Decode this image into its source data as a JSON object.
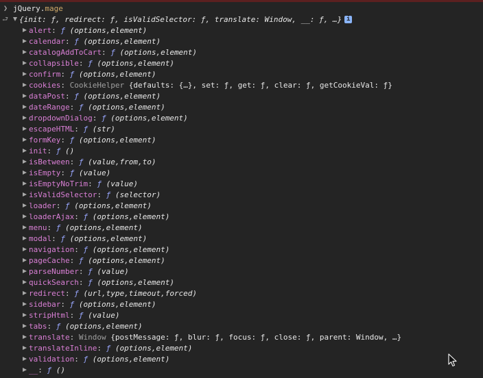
{
  "colors": {
    "background": "#242424",
    "key": "#d97fd5",
    "function_symbol": "#9aa8ff",
    "text": "#e8e8e8",
    "class_name": "#a0a0a0",
    "accent_top": "#5c2020"
  },
  "input": {
    "object": "jQuery.",
    "property": "mage"
  },
  "summary": {
    "text": "{init: ƒ, redirect: ƒ, isValidSelector: ƒ, translate: Window, __: ƒ, …}",
    "info_badge": "i"
  },
  "properties": [
    {
      "key": "alert",
      "sym": "ƒ",
      "sig": "(options,element)"
    },
    {
      "key": "calendar",
      "sym": "ƒ",
      "sig": "(options,element)"
    },
    {
      "key": "catalogAddToCart",
      "sym": "ƒ",
      "sig": "(options,element)"
    },
    {
      "key": "collapsible",
      "sym": "ƒ",
      "sig": "(options,element)"
    },
    {
      "key": "confirm",
      "sym": "ƒ",
      "sig": "(options,element)"
    },
    {
      "key": "cookies",
      "cls": "CookieHelper",
      "rest": "{defaults: {…}, set: ƒ, get: ƒ, clear: ƒ, getCookieVal: ƒ}"
    },
    {
      "key": "dataPost",
      "sym": "ƒ",
      "sig": "(options,element)"
    },
    {
      "key": "dateRange",
      "sym": "ƒ",
      "sig": "(options,element)"
    },
    {
      "key": "dropdownDialog",
      "sym": "ƒ",
      "sig": "(options,element)"
    },
    {
      "key": "escapeHTML",
      "sym": "ƒ",
      "sig": "(str)"
    },
    {
      "key": "formKey",
      "sym": "ƒ",
      "sig": "(options,element)"
    },
    {
      "key": "init",
      "sym": "ƒ",
      "sig": "()"
    },
    {
      "key": "isBetween",
      "sym": "ƒ",
      "sig": "(value,from,to)"
    },
    {
      "key": "isEmpty",
      "sym": "ƒ",
      "sig": "(value)"
    },
    {
      "key": "isEmptyNoTrim",
      "sym": "ƒ",
      "sig": "(value)"
    },
    {
      "key": "isValidSelector",
      "sym": "ƒ",
      "sig": "(selector)"
    },
    {
      "key": "loader",
      "sym": "ƒ",
      "sig": "(options,element)"
    },
    {
      "key": "loaderAjax",
      "sym": "ƒ",
      "sig": "(options,element)"
    },
    {
      "key": "menu",
      "sym": "ƒ",
      "sig": "(options,element)"
    },
    {
      "key": "modal",
      "sym": "ƒ",
      "sig": "(options,element)"
    },
    {
      "key": "navigation",
      "sym": "ƒ",
      "sig": "(options,element)"
    },
    {
      "key": "pageCache",
      "sym": "ƒ",
      "sig": "(options,element)"
    },
    {
      "key": "parseNumber",
      "sym": "ƒ",
      "sig": "(value)"
    },
    {
      "key": "quickSearch",
      "sym": "ƒ",
      "sig": "(options,element)"
    },
    {
      "key": "redirect",
      "sym": "ƒ",
      "sig": "(url,type,timeout,forced)"
    },
    {
      "key": "sidebar",
      "sym": "ƒ",
      "sig": "(options,element)"
    },
    {
      "key": "stripHtml",
      "sym": "ƒ",
      "sig": "(value)"
    },
    {
      "key": "tabs",
      "sym": "ƒ",
      "sig": "(options,element)"
    },
    {
      "key": "translate",
      "cls": "Window",
      "rest": "{postMessage: ƒ, blur: ƒ, focus: ƒ, close: ƒ, parent: Window, …}"
    },
    {
      "key": "translateInline",
      "sym": "ƒ",
      "sig": "(options,element)"
    },
    {
      "key": "validation",
      "sym": "ƒ",
      "sig": "(options,element)"
    },
    {
      "key": "__",
      "sym": "ƒ",
      "sig": "()"
    }
  ]
}
